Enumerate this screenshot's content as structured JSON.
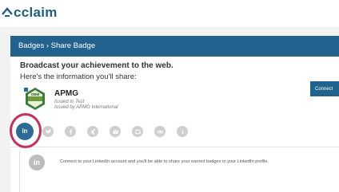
{
  "app": {
    "brand_name": "cclaim",
    "brand_color": "#1f5d82"
  },
  "header": {
    "breadcrumb": "Badges › Share Badge",
    "bg_color": "#21628f"
  },
  "intro": {
    "heading": "Broadcast your achievement to the web.",
    "subheading": "Here's the information you'll share:"
  },
  "badge": {
    "name": "APMG",
    "issued_to": "Issued to Test",
    "issued_by": "Issued by APMG International",
    "image_lettering": "OBM"
  },
  "share_tabs": [
    {
      "name": "linkedin",
      "label": "in",
      "icon": "linkedin-icon",
      "active": true
    },
    {
      "name": "twitter",
      "icon": "twitter-icon",
      "active": false
    },
    {
      "name": "facebook",
      "icon": "facebook-icon",
      "active": false
    },
    {
      "name": "xing",
      "icon": "xing-icon",
      "active": false
    },
    {
      "name": "email",
      "icon": "email-icon",
      "active": false
    },
    {
      "name": "embed",
      "icon": "embed-icon",
      "active": false
    },
    {
      "name": "link",
      "icon": "link-icon",
      "active": false
    },
    {
      "name": "info",
      "icon": "info-icon",
      "active": false
    }
  ],
  "linkedin_panel": {
    "avatar_label": "in",
    "description": "Connect to your LinkedIn account and you'll be able to share your earned badges to your LinkedIn profile.",
    "connect_label": "Connect"
  },
  "highlight_color": "#c5305e"
}
